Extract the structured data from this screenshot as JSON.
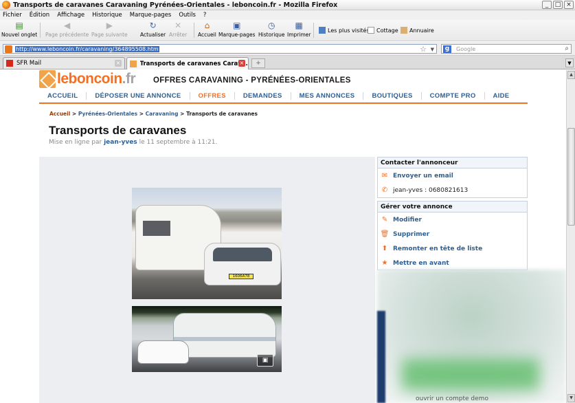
{
  "window": {
    "title": "Transports de caravanes Caravaning Pyrénées-Orientales - leboncoin.fr - Mozilla Firefox",
    "buttons": [
      "_",
      "□",
      "×"
    ]
  },
  "menu": [
    "Fichier",
    "Édition",
    "Affichage",
    "Historique",
    "Marque-pages",
    "Outils",
    "?"
  ],
  "toolbar": {
    "new_tab": "Nouvel onglet",
    "back": "Page précédente",
    "forward": "Page suivante",
    "reload": "Actualiser",
    "stop": "Arrêter",
    "home": "Accueil",
    "bookmarks": "Marque-pages",
    "history": "Historique",
    "print": "Imprimer",
    "bm_most_visited": "Les plus visités",
    "bm_cottage": "Cottage",
    "bm_annuaire": "Annuaire"
  },
  "address": {
    "url": "http://www.leboncoin.fr/caravaning/364895508.htm",
    "search_placeholder": "Google"
  },
  "tabs": [
    {
      "label": "SFR Mail",
      "active": false
    },
    {
      "label": "Transports de caravanes Carava...",
      "active": true
    }
  ],
  "site": {
    "logo_main": "leboncoin",
    "logo_tld": ".fr",
    "section_title": "OFFRES CARAVANING - PYRÉNÉES-ORIENTALES",
    "nav": [
      "ACCUEIL",
      "DÉPOSER UNE ANNONCE",
      "OFFRES",
      "DEMANDES",
      "MES ANNONCES",
      "BOUTIQUES",
      "COMPTE PRO",
      "AIDE"
    ],
    "nav_active": "OFFRES"
  },
  "breadcrumb": {
    "items": [
      "Accueil",
      "Pyrénées-Orientales",
      "Caravaning",
      "Transports de caravanes"
    ],
    "sep": ">"
  },
  "ad": {
    "title": "Transports de caravanes",
    "posted_prefix": "Mise en ligne par",
    "author": "jean-yves",
    "posted_suffix": "le 11 septembre à 11:21.",
    "photo1_plate": "1606A78"
  },
  "contact": {
    "header": "Contacter l'annonceur",
    "email": "Envoyer un email",
    "phone": "jean-yves : 0680821613"
  },
  "manage": {
    "header": "Gérer votre annonce",
    "items": [
      "Modifier",
      "Supprimer",
      "Remonter en tête de liste",
      "Mettre en avant"
    ]
  },
  "promo": {
    "text": "ouvrir un compte demo"
  },
  "colors": {
    "brand_orange": "#f36f21",
    "link_blue": "#2e5f93"
  }
}
